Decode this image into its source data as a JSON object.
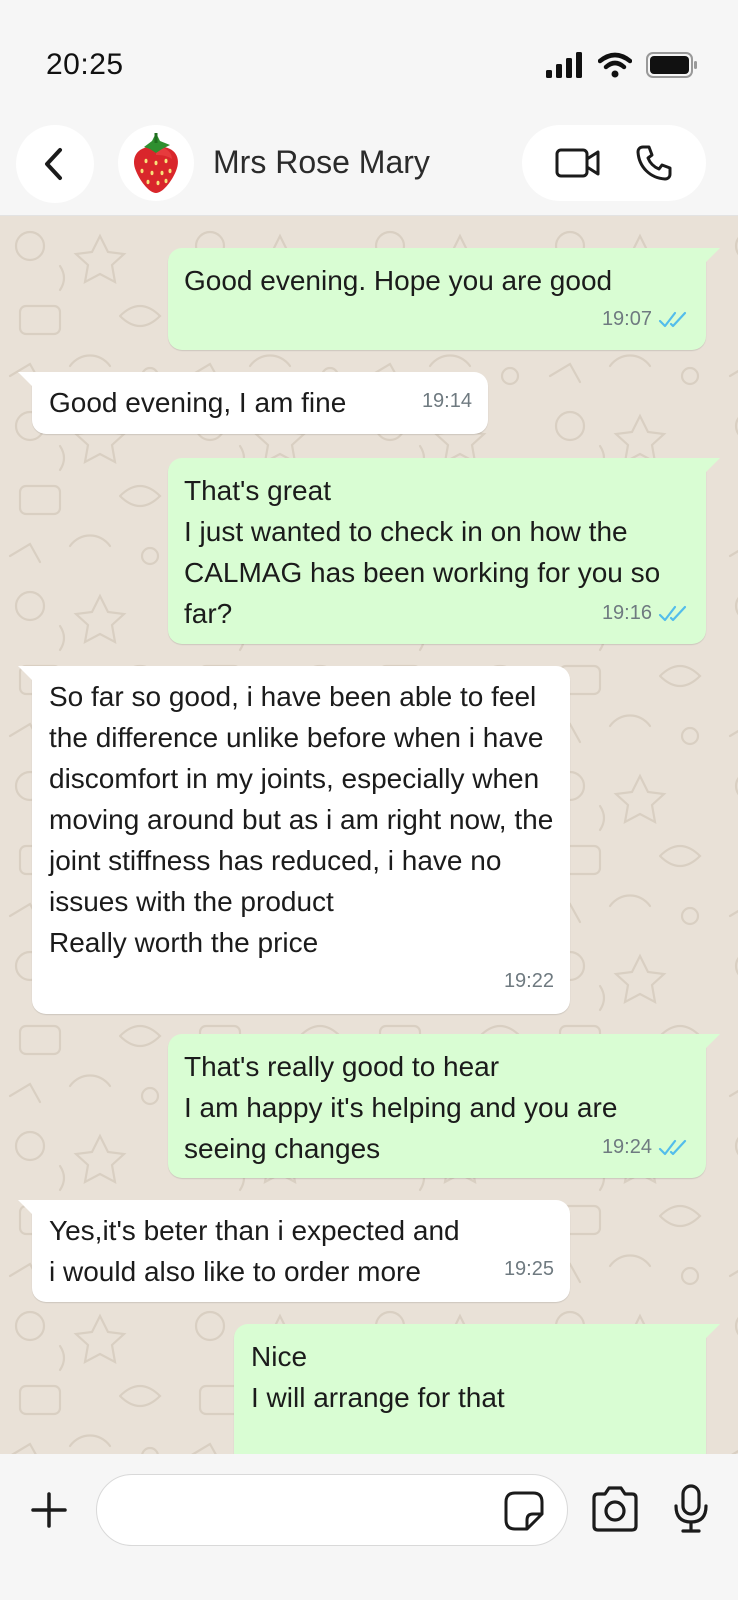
{
  "status_bar": {
    "time": "20:25"
  },
  "header": {
    "contact_name": "Mrs Rose Mary",
    "icons": {
      "back": "chevron-left-icon",
      "avatar": "strawberry",
      "video": "video-call-icon",
      "phone": "phone-icon"
    }
  },
  "messages": [
    {
      "dir": "out",
      "text": "Good evening. Hope you are good",
      "time": "19:07",
      "read": true
    },
    {
      "dir": "in",
      "text": "Good evening, I am fine",
      "time": "19:14"
    },
    {
      "dir": "out",
      "text": "That's great\nI just wanted to check in on how the CALMAG has been working for you so far?",
      "time": "19:16",
      "read": true
    },
    {
      "dir": "in",
      "text": "So far so good, i have been able to feel the difference unlike before when i have discomfort in my joints, especially when moving around but as i am right now, the joint stiffness has reduced, i have no issues with the product\nReally worth the price",
      "time": "19:22"
    },
    {
      "dir": "out",
      "text": "That's really good to hear\nI am happy it's helping and you are seeing changes",
      "time": "19:24",
      "read": true
    },
    {
      "dir": "in",
      "text": "Yes,it's beter than i expected and i would also like to order more",
      "time": "19:25"
    },
    {
      "dir": "out",
      "text": "Nice\nI will arrange for that",
      "time": "",
      "read": false
    }
  ],
  "input_bar": {
    "placeholder": "",
    "icons": [
      "plus-icon",
      "sticker-icon",
      "camera-icon",
      "microphone-icon"
    ]
  },
  "colors": {
    "outgoing": "#d9fdd3",
    "incoming": "#ffffff",
    "read_ticks": "#53bdeb",
    "wallpaper": "#e9e1d7"
  }
}
